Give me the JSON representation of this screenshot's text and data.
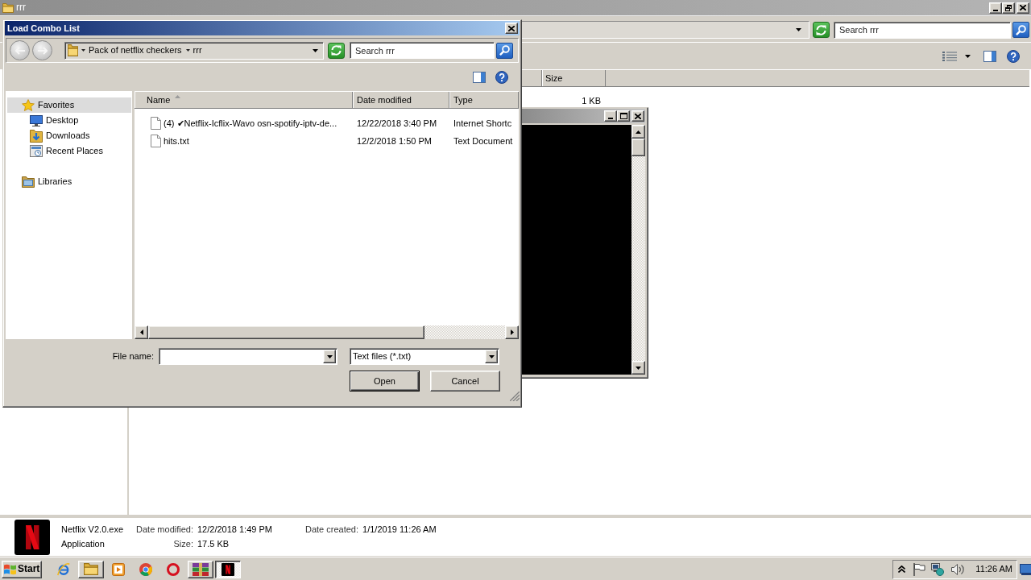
{
  "explorer": {
    "title": "rrr",
    "search": {
      "placeholder": "Search rrr"
    },
    "columns": [
      {
        "label": "Size"
      }
    ],
    "rows": [
      {
        "size": "1 KB"
      }
    ],
    "details": {
      "name": "Netflix V2.0.exe",
      "type": "Application",
      "fields": [
        {
          "label": "Date modified:",
          "value": "12/2/2018 1:49 PM"
        },
        {
          "label": "Size:",
          "value": "17.5 KB"
        },
        {
          "label": "Date created:",
          "value": "1/1/2019 11:26 AM"
        }
      ]
    }
  },
  "dialog": {
    "title": "Load Combo List",
    "breadcrumb": [
      "Pack of netflix checkers",
      "rrr"
    ],
    "search": {
      "placeholder": "Search rrr"
    },
    "nav": [
      {
        "label": "Favorites",
        "selected": true,
        "children": [
          {
            "label": "Desktop",
            "selected": false
          },
          {
            "label": "Downloads",
            "selected": false
          },
          {
            "label": "Recent Places",
            "selected": false
          }
        ]
      },
      {
        "label": "Libraries",
        "selected": false
      }
    ],
    "columns": [
      {
        "label": "Name",
        "sorted": true
      },
      {
        "label": "Date modified",
        "sorted": false
      },
      {
        "label": "Type",
        "sorted": false
      }
    ],
    "files": [
      {
        "name": "(4) ✔Netflix-Icflix-Wavo osn-spotify-iptv-de...",
        "date_modified": "12/22/2018 3:40 PM",
        "type": "Internet Shortc"
      },
      {
        "name": "hits.txt",
        "date_modified": "12/2/2018 1:50 PM",
        "type": "Text Document"
      }
    ],
    "file_name": {
      "label": "File name:"
    },
    "filter": "Text files (*.txt)",
    "buttons": [
      {
        "label": "Open",
        "default": true
      },
      {
        "label": "Cancel",
        "default": false
      }
    ]
  },
  "taskbar": {
    "start": "Start",
    "apps": [
      {
        "running": false,
        "selected": false
      },
      {
        "running": true,
        "selected": false
      },
      {
        "running": false,
        "selected": false
      },
      {
        "running": false,
        "selected": false
      },
      {
        "running": false,
        "selected": false
      },
      {
        "running": true,
        "selected": false
      },
      {
        "running": true,
        "selected": true
      }
    ],
    "clock": "11:26 AM"
  }
}
